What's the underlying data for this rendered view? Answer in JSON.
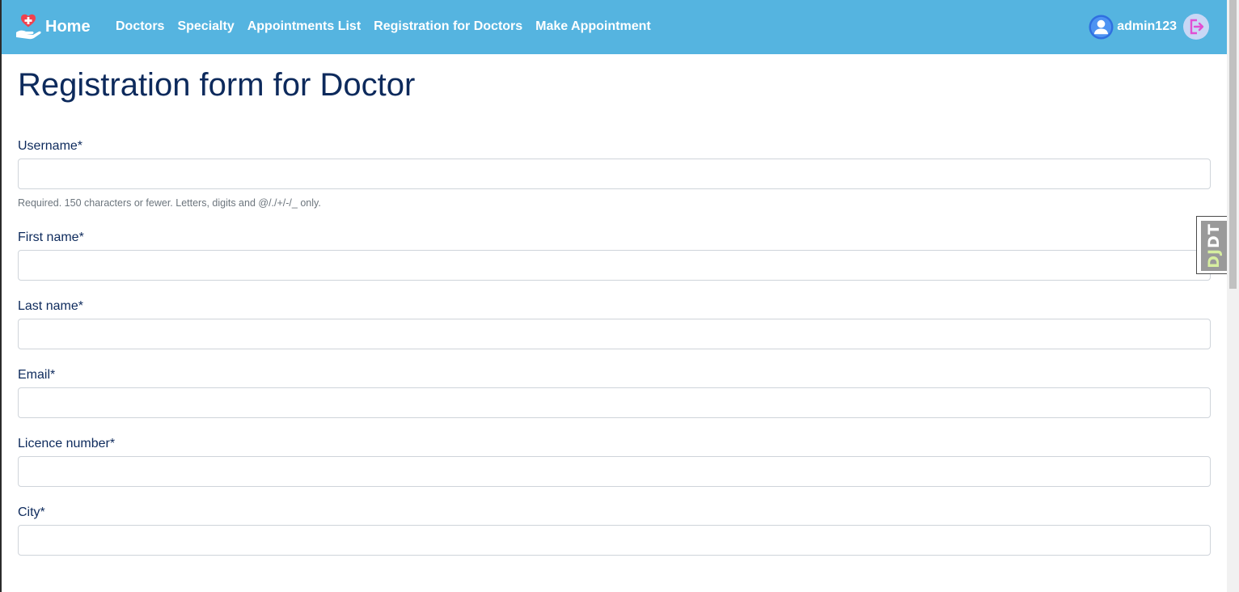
{
  "navbar": {
    "brand_label": "Home",
    "brand_icon": "heart-hand-logo-icon",
    "links": [
      "Doctors",
      "Specialty",
      "Appointments List",
      "Registration for Doctors",
      "Make Appointment"
    ],
    "username": "admin123",
    "avatar_icon": "user-avatar-icon",
    "logout_icon": "logout-icon",
    "background_color": "#55b4e0"
  },
  "form": {
    "title": "Registration form for Doctor",
    "fields": [
      {
        "label": "Username*",
        "value": "",
        "help": "Required. 150 characters or fewer. Letters, digits and @/./+/-/_ only."
      },
      {
        "label": "First name*",
        "value": ""
      },
      {
        "label": "Last name*",
        "value": ""
      },
      {
        "label": "Email*",
        "value": ""
      },
      {
        "label": "Licence number*",
        "value": ""
      },
      {
        "label": "City*",
        "value": ""
      }
    ]
  },
  "debug_toolbar": {
    "prefix": "DJ",
    "suffix": "DT"
  },
  "colors": {
    "title_text": "#0d2a5c",
    "help_text": "#6c757d",
    "input_border": "#cfd4da"
  }
}
